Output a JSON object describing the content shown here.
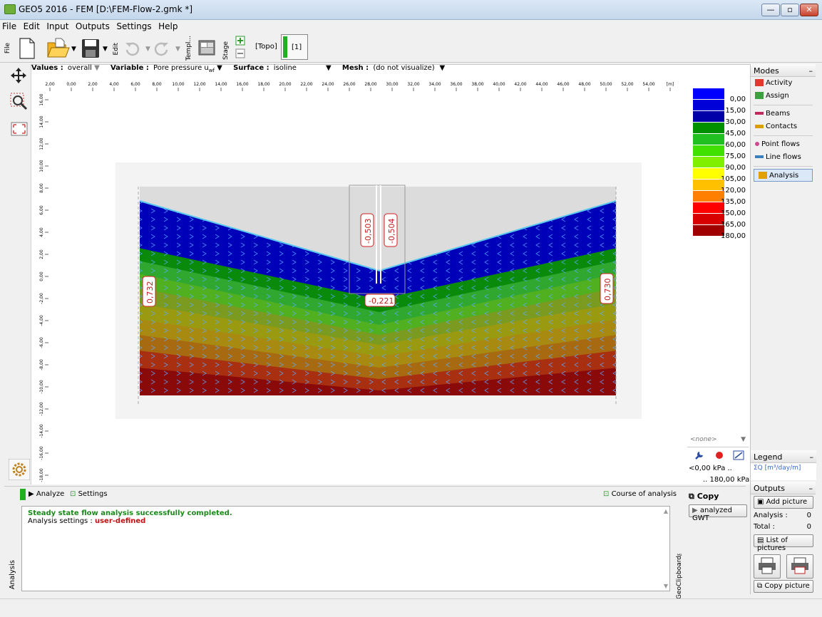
{
  "window": {
    "title": "GEO5 2016 - FEM [D:\\FEM-Flow-2.gmk *]",
    "minimize": "—",
    "restore": "▫",
    "close": "✕"
  },
  "menu": [
    "File",
    "Edit",
    "Input",
    "Outputs",
    "Settings",
    "Help"
  ],
  "toolbar": {
    "file_label": "File",
    "edit_label": "Edit",
    "templ_label": "Templ...",
    "stage_label": "Stage",
    "topo_label": "[Topo]",
    "stage1_label": "[1]"
  },
  "options": {
    "values_label": "Values :",
    "values_value": "overall",
    "variable_label": "Variable :",
    "variable_value": "Pore pressure u",
    "variable_sub": "wf",
    "surface_label": "Surface :",
    "surface_value": "isoline",
    "mesh_label": "Mesh :",
    "mesh_value": "(do not visualize)"
  },
  "ruler": {
    "x_ticks": [
      "2,00",
      "0,00",
      "2,00",
      "4,00",
      "6,00",
      "8,00",
      "10,00",
      "12,00",
      "14,00",
      "16,00",
      "18,00",
      "20,00",
      "22,00",
      "24,00",
      "26,00",
      "28,00",
      "30,00",
      "32,00",
      "34,00",
      "36,00",
      "38,00",
      "40,00",
      "42,00",
      "44,00",
      "46,00",
      "48,00",
      "50,00",
      "52,00",
      "54,00",
      "[m]"
    ],
    "y_ticks": [
      "16,00",
      "14,00",
      "12,00",
      "10,00",
      "8,00",
      "6,00",
      "4,00",
      "2,00",
      "0,00",
      "-2,00",
      "-4,00",
      "-6,00",
      "-8,00",
      "-10,00",
      "-12,00",
      "-14,00",
      "-16,00",
      "-18,00"
    ]
  },
  "labels": {
    "left": "0,732",
    "right": "0,730",
    "center_left": "-0,503",
    "center_right": "-0,504",
    "bottom": "-0,221"
  },
  "legend": {
    "values": [
      "0,00",
      "15,00",
      "30,00",
      "45,00",
      "60,00",
      "75,00",
      "90,00",
      "105,00",
      "120,00",
      "135,00",
      "150,00",
      "165,00",
      "180,00"
    ],
    "colors": [
      "#0000ff",
      "#0000d8",
      "#0000a8",
      "#009000",
      "#20c020",
      "#40e000",
      "#80f000",
      "#ffff00",
      "#ffc000",
      "#ff8000",
      "#ff0000",
      "#d80000",
      "#a00000"
    ],
    "dropdown": "<none>",
    "min_text": "<0,00 kPa ..",
    "max_text": ".. 180,00 kPa>"
  },
  "modes": {
    "title": "Modes",
    "items": [
      {
        "label": "Activity",
        "color": "#e03a2a"
      },
      {
        "label": "Assign",
        "color": "#3aa040"
      },
      {
        "label": "Beams",
        "color": "#c02a5a"
      },
      {
        "label": "Contacts",
        "color": "#d8a000"
      },
      {
        "label": "Point flows",
        "color": "#d04890"
      },
      {
        "label": "Line flows",
        "color": "#3a80c0"
      },
      {
        "label": "Analysis",
        "color": "#e0a000"
      }
    ]
  },
  "legend_panel": {
    "title": "Legend",
    "item": "ΣQ [m³/day/m]"
  },
  "outputs": {
    "title": "Outputs",
    "add_picture": "Add picture",
    "analysis_label": "Analysis :",
    "analysis_value": "0",
    "total_label": "Total :",
    "total_value": "0",
    "list_pictures": "List of pictures",
    "copy_picture": "Copy picture"
  },
  "bottom": {
    "side_label": "Analysis",
    "analyze": "Analyze",
    "settings": "Settings",
    "course": "Course of analysis",
    "msg1": "Steady state flow analysis successfully completed.",
    "msg2_label": "Analysis settings : ",
    "msg2_value": "user-defined",
    "clip_label": "GeoClipboard™",
    "copy": "Copy",
    "gwt": "analyzed GWT"
  }
}
